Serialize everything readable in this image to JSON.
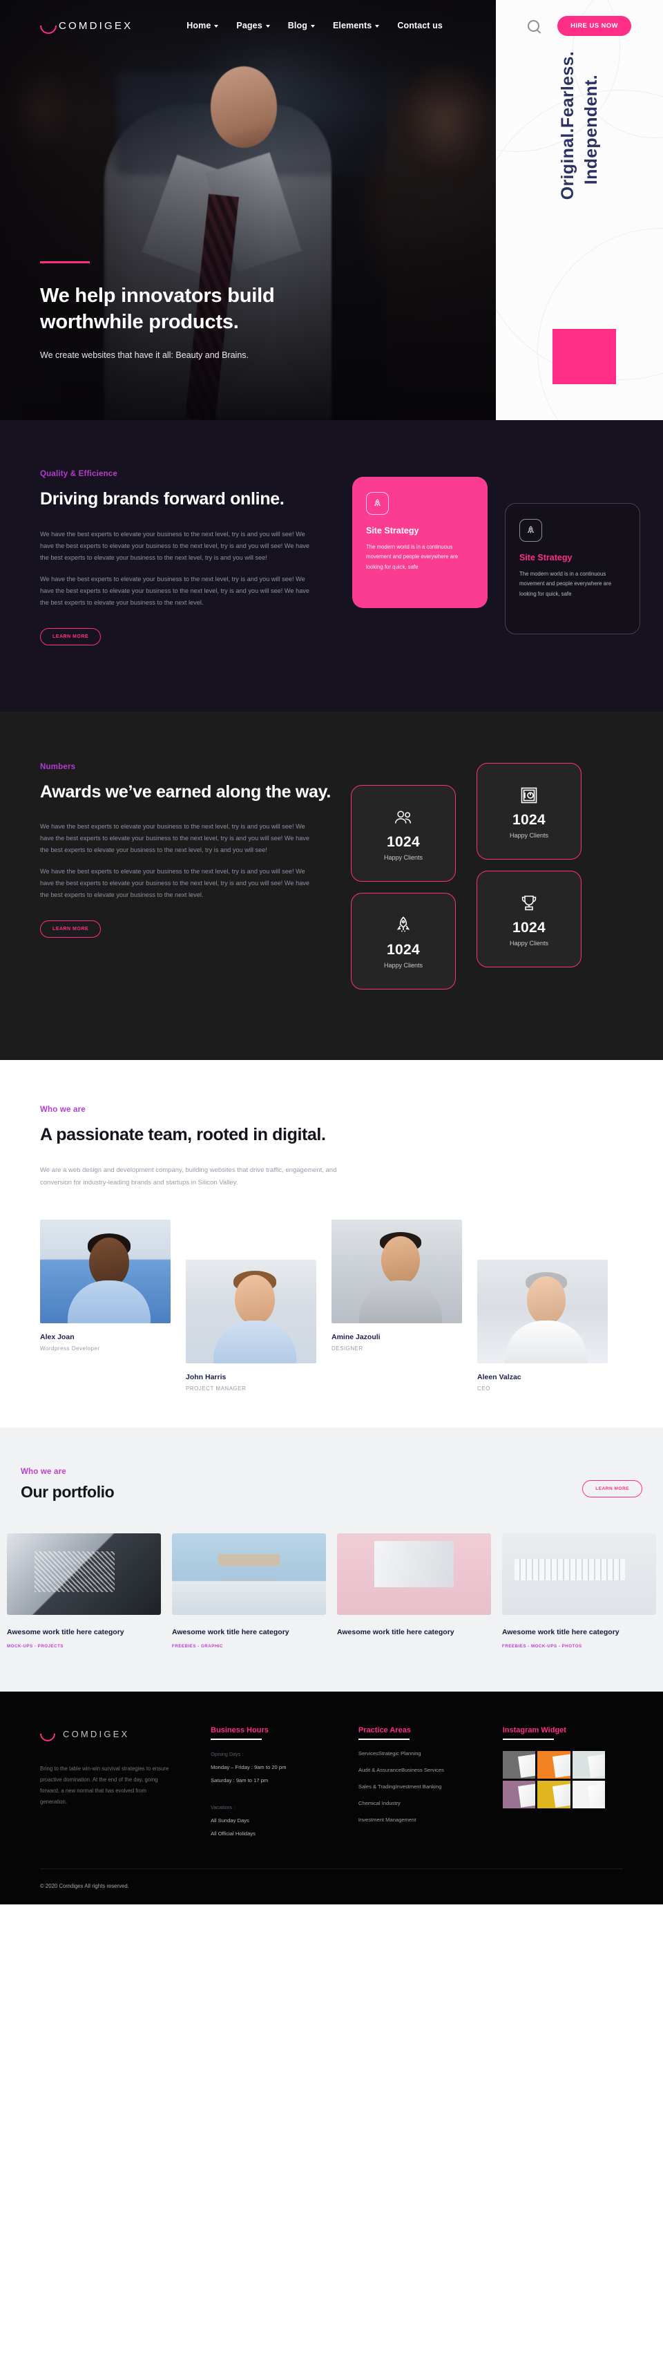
{
  "brand": {
    "name": "COMDIGEX"
  },
  "nav": {
    "links": [
      {
        "label": "Home",
        "has_caret": true
      },
      {
        "label": "Pages",
        "has_caret": true
      },
      {
        "label": "Blog",
        "has_caret": true
      },
      {
        "label": "Elements",
        "has_caret": true
      },
      {
        "label": "Contact us",
        "has_caret": false
      }
    ],
    "search_icon": "search-icon",
    "cta_label": "HIRE US NOW"
  },
  "hero": {
    "title": "We help innovators build worthwhile products.",
    "subtitle": "We create websites that have it all: Beauty and Brains.",
    "vertical_line1": "Original.Fearless.",
    "vertical_line2": "Independent."
  },
  "drive": {
    "eyebrow": "Quality & Efficience",
    "title": "Driving brands forward online.",
    "paragraph1": "We have the best experts to elevate your business to the next level, try is and you will see! We have the best experts to elevate your business to the next level, try is and you will see! We have the best experts to elevate your business to the next level, try is and you will see!",
    "paragraph2": "We have the best experts to elevate your business to the next level, try is and you will see! We have the best experts to elevate your business to the next level, try is and you will see! We have the best experts to elevate your business to the next level.",
    "button_label": "LEARN MORE",
    "cards": [
      {
        "icon": "rocket-icon",
        "title": "Site Strategy",
        "text": "The modern world is in a continuous movement and people everywhere are looking for quick, safe"
      },
      {
        "icon": "rocket-icon",
        "title": "Site Strategy",
        "text": "The modern world is in a continuous movement and people everywhere are looking for quick, safe"
      }
    ]
  },
  "numbers": {
    "eyebrow": "Numbers",
    "title": "Awards we’ve earned along the way.",
    "paragraph1": "We have the best experts to elevate your business to the next level, try is and you will see! We have the best experts to elevate your business to the next level, try is and you will see! We have the best experts to elevate your business to the next level, try is and you will see!",
    "paragraph2": "We have the best experts to elevate your business to the next level, try is and you will see! We have the best experts to elevate your business to the next level, try is and you will see! We have the best experts to elevate your business to the next level.",
    "button_label": "LEARN MORE",
    "stats": [
      {
        "icon": "users-icon",
        "value": "1024",
        "label": "Happy Clients"
      },
      {
        "icon": "safe-icon",
        "value": "1024",
        "label": "Happy Clients"
      },
      {
        "icon": "rocket-icon",
        "value": "1024",
        "label": "Happy Clients"
      },
      {
        "icon": "trophy-icon",
        "value": "1024",
        "label": "Happy Clients"
      }
    ]
  },
  "team": {
    "eyebrow": "Who we are",
    "title": "A passionate team, rooted in digital.",
    "paragraph": "We are a web design and development company, building websites that drive traffic, engagement, and conversion for industry-leading brands and startups in Silicon Valley.",
    "members": [
      {
        "name": "Alex Joan",
        "role": "Wordpress Developer"
      },
      {
        "name": "John Harris",
        "role": "PROJECT MANAGER"
      },
      {
        "name": "Amine Jazouli",
        "role": "DESIGNER"
      },
      {
        "name": "Aleen Valzac",
        "role": "CEO"
      }
    ]
  },
  "portfolio": {
    "eyebrow": "Who we are",
    "title": "Our portfolio",
    "button_label": "LEARN MORE",
    "items": [
      {
        "title": "Awesome work title here category",
        "tags": "MOCK-UPS  -  PROJECTS"
      },
      {
        "title": "Awesome work title here category",
        "tags": "FREEBIES  -  GRAPHIC"
      },
      {
        "title": "Awesome work title here category",
        "tags": ""
      },
      {
        "title": "Awesome work title here category",
        "tags": "FREEBIES  -  MOCK-UPS  -  PHOTOS"
      }
    ]
  },
  "footer": {
    "brand_name": "COMDIGEX",
    "about": "Bring to the table win-win survival strategies to ensure proactive domination. At the end of the day, going forward, a new normal that has evolved from generation.",
    "hours": {
      "heading": "Business Hours",
      "opening_label": "Opining Days :",
      "opening": [
        "Monday – Friday : 9am to 20 pm",
        "Saturday : 9am to 17 pm"
      ],
      "vacations_label": "Vacations :",
      "vacations": [
        "All Sunday Days",
        "All Official Holidays"
      ]
    },
    "areas": {
      "heading": "Practice Areas",
      "items": [
        "ServicesStrategic Planning",
        "Audit & AssuranceBusiness Services",
        "Sales & TradingInvestment Banking",
        "Chemical Industry",
        "Investment Management"
      ]
    },
    "instagram": {
      "heading": "Instagram Widget",
      "tiles": 6
    },
    "copyright": "© 2020 Comdigex All rights reserved."
  },
  "colors": {
    "accent": "#ff2e87",
    "dark": "#17121f",
    "numbers_bg": "#1c1c1c",
    "navy": "#2a3260"
  }
}
